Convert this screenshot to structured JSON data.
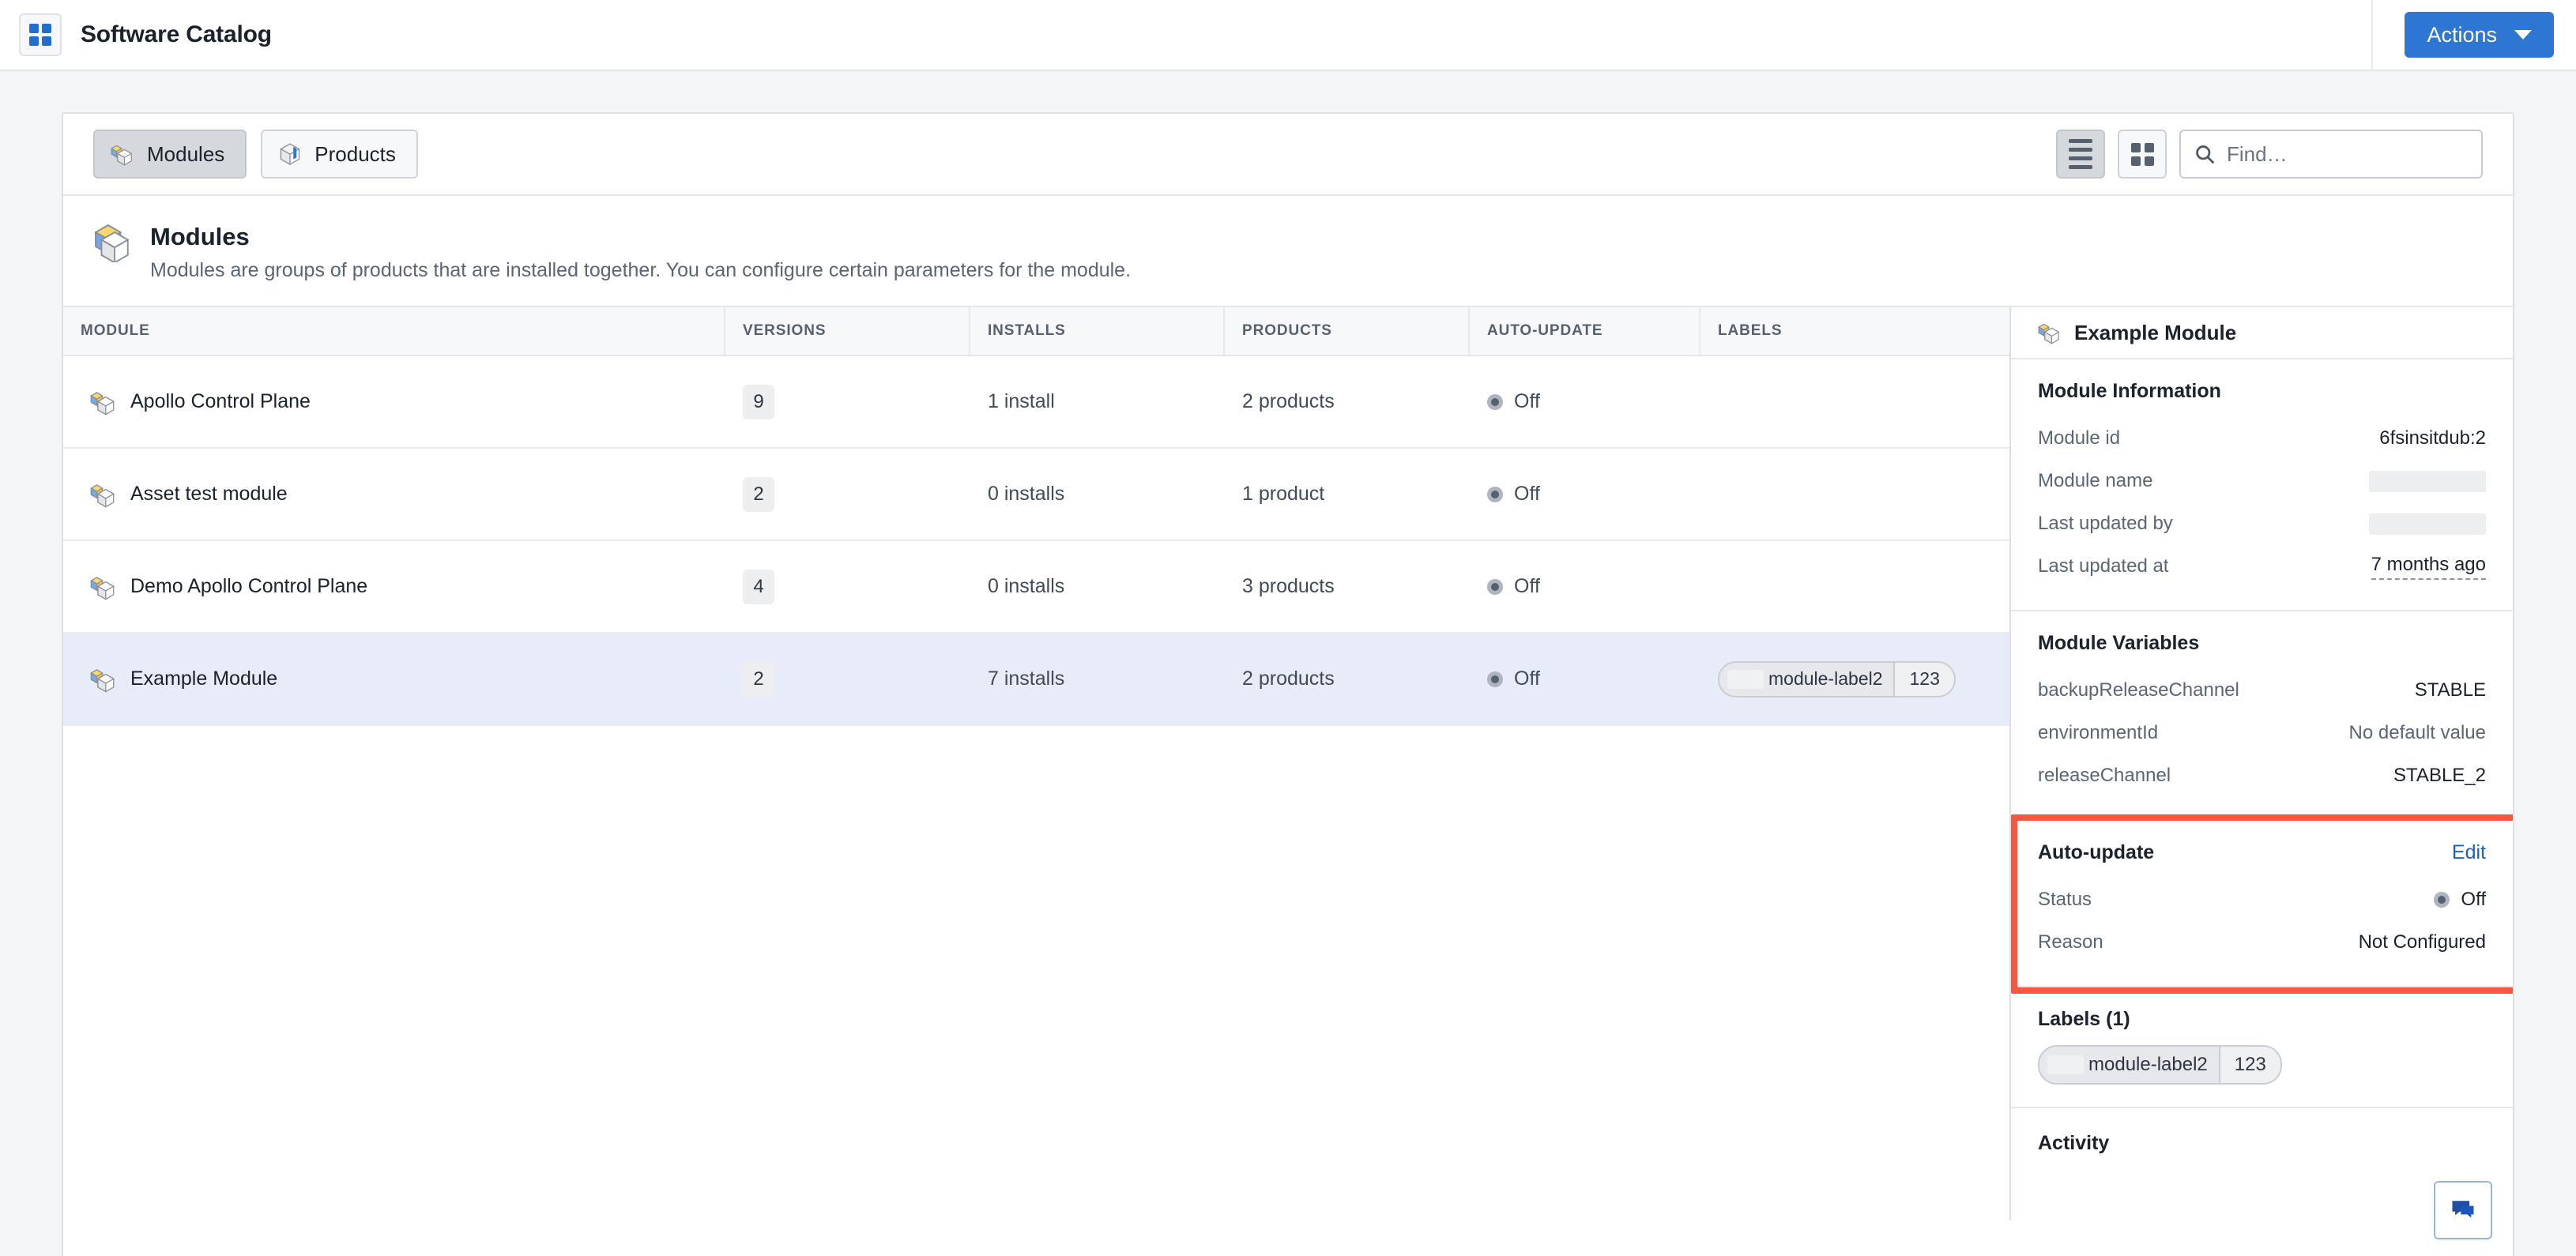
{
  "app": {
    "title": "Software Catalog",
    "logo_icon": "grid-logo-icon",
    "accent": "#2d76d2",
    "highlight_color": "#f9573f"
  },
  "header": {
    "actions_label": "Actions",
    "caret_icon": "chevron-down-icon"
  },
  "toolbar": {
    "tabs": [
      {
        "label": "Modules",
        "icon": "module-icon",
        "active": true
      },
      {
        "label": "Products",
        "icon": "product-icon",
        "active": false
      }
    ],
    "view_list_icon": "list-view-icon",
    "view_grid_icon": "grid-view-icon",
    "search": {
      "placeholder": "Find…",
      "value": "",
      "icon": "search-icon"
    }
  },
  "section": {
    "icon": "module-icon",
    "title": "Modules",
    "description": "Modules are groups of products that are installed together. You can configure certain parameters for the module."
  },
  "table": {
    "columns": [
      "MODULE",
      "VERSIONS",
      "INSTALLS",
      "PRODUCTS",
      "AUTO-UPDATE",
      "LABELS"
    ],
    "rows": [
      {
        "module": "Apollo Control Plane",
        "versions": "9",
        "installs": "1 install",
        "products": "2 products",
        "auto_update": "Off",
        "labels": [],
        "selected": false
      },
      {
        "module": "Asset test module",
        "versions": "2",
        "installs": "0 installs",
        "products": "1 product",
        "auto_update": "Off",
        "labels": [],
        "selected": false
      },
      {
        "module": "Demo Apollo Control Plane",
        "versions": "4",
        "installs": "0 installs",
        "products": "3 products",
        "auto_update": "Off",
        "labels": [],
        "selected": false
      },
      {
        "module": "Example Module",
        "versions": "2",
        "installs": "7 installs",
        "products": "2 products",
        "auto_update": "Off",
        "labels": [
          {
            "key": "module-label2",
            "value": "123",
            "redacted_prefix": true
          }
        ],
        "selected": true
      }
    ]
  },
  "detail": {
    "title": "Example Module",
    "icon": "module-icon",
    "module_information": {
      "heading": "Module Information",
      "rows": [
        {
          "label": "Module id",
          "value": "6fsinsitdub:2",
          "redacted": false,
          "dashed": false
        },
        {
          "label": "Module name",
          "value": "",
          "redacted": true,
          "dashed": false
        },
        {
          "label": "Last updated by",
          "value": "",
          "redacted": true,
          "dashed": false
        },
        {
          "label": "Last updated at",
          "value": "7 months ago",
          "redacted": false,
          "dashed": true
        }
      ]
    },
    "module_variables": {
      "heading": "Module Variables",
      "rows": [
        {
          "label": "backupReleaseChannel",
          "value": "STABLE",
          "muted": false
        },
        {
          "label": "environmentId",
          "value": "No default value",
          "muted": true
        },
        {
          "label": "releaseChannel",
          "value": "STABLE_2",
          "muted": false
        }
      ]
    },
    "auto_update": {
      "heading": "Auto-update",
      "edit_label": "Edit",
      "status_label": "Status",
      "status_value": "Off",
      "reason_label": "Reason",
      "reason_value": "Not Configured",
      "highlighted": true
    },
    "labels": {
      "heading": "Labels (1)",
      "chips": [
        {
          "key": "module-label2",
          "value": "123",
          "redacted_prefix": true
        }
      ]
    },
    "activity": {
      "heading": "Activity"
    },
    "feedback_icon": "feedback-chat-icon"
  }
}
